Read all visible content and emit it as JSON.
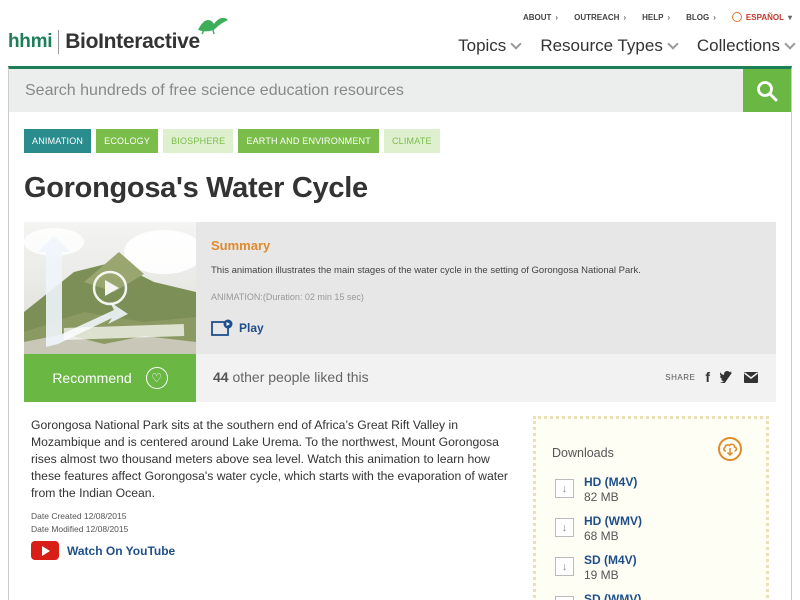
{
  "header": {
    "logo_hhmi": "hhmi",
    "logo_bio": "BioInteractive",
    "utility_nav": [
      "ABOUT",
      "OUTREACH",
      "HELP",
      "BLOG"
    ],
    "language": "ESPAÑOL",
    "main_nav": [
      "Topics",
      "Resource Types",
      "Collections"
    ]
  },
  "search": {
    "placeholder": "Search hundreds of free science education resources"
  },
  "tags": [
    "ANIMATION",
    "ECOLOGY",
    "BIOSPHERE",
    "EARTH AND ENVIRONMENT",
    "CLIMATE"
  ],
  "page": {
    "title": "Gorongosa's Water Cycle"
  },
  "summary": {
    "heading": "Summary",
    "description": "This animation illustrates the main stages of the water cycle in the setting of Gorongosa National Park.",
    "meta": "ANIMATION:(Duration: 02 min 15 sec)",
    "play_label": "Play"
  },
  "social": {
    "recommend_label": "Recommend",
    "likes_count": "44",
    "likes_text": "other people liked this",
    "share_label": "SHARE"
  },
  "body": {
    "description": "Gorongosa National Park sits at the southern end of Africa’s Great Rift Valley in Mozambique and is centered around Lake Urema. To the northwest, Mount Gorongosa rises almost two thousand meters above sea level. Watch this animation to learn how these features affect Gorongosa's water cycle, which starts with the evaporation of water from the Indian Ocean.",
    "date_created": "Date Created 12/08/2015",
    "date_modified": "Date Modified 12/08/2015",
    "youtube_label": "Watch On YouTube"
  },
  "downloads": {
    "title": "Downloads",
    "items": [
      {
        "name": "HD (M4V)",
        "size": "82 MB"
      },
      {
        "name": "HD (WMV)",
        "size": "68 MB"
      },
      {
        "name": "SD (M4V)",
        "size": "19 MB"
      },
      {
        "name": "SD (WMV)",
        "size": ""
      }
    ]
  },
  "colors": {
    "brand_green": "#1d7f57",
    "accent_green": "#6ab744",
    "tag_teal": "#2a8c8c",
    "orange": "#e08a2a",
    "link_blue": "#1f4f8a"
  }
}
